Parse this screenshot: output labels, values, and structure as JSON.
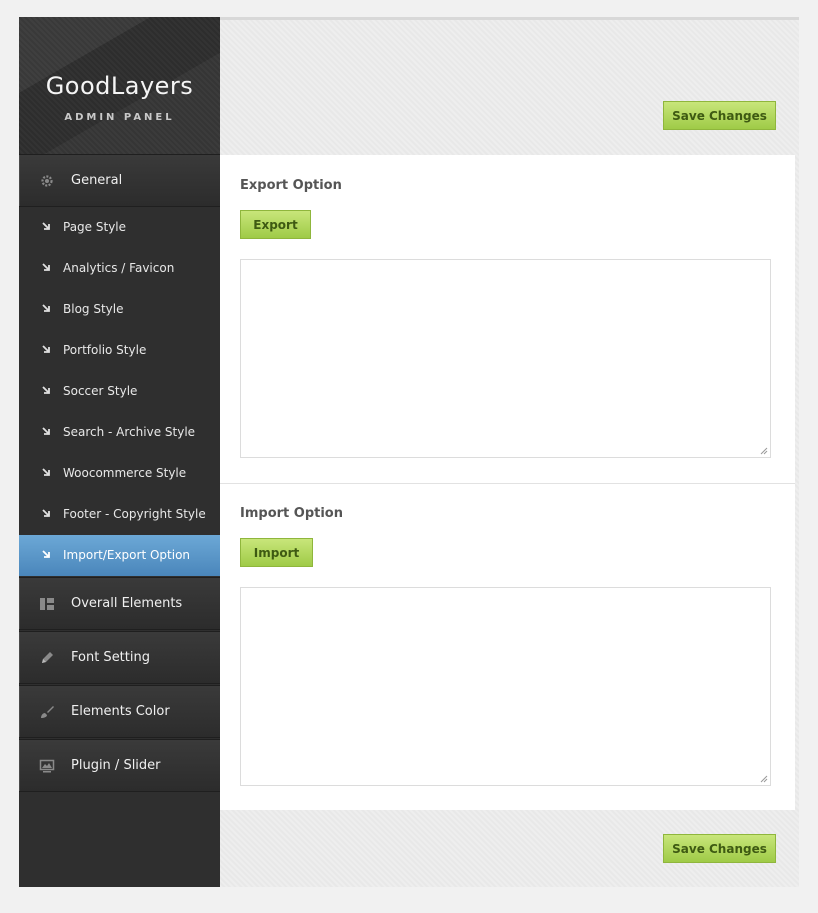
{
  "brand": {
    "title": "GoodLayers",
    "subtitle": "ADMIN PANEL"
  },
  "nav": {
    "general": {
      "label": "General",
      "icon": "gear-icon"
    },
    "sub_items": [
      {
        "label": "Page Style"
      },
      {
        "label": "Analytics / Favicon"
      },
      {
        "label": "Blog Style"
      },
      {
        "label": "Portfolio Style"
      },
      {
        "label": "Soccer Style"
      },
      {
        "label": "Search - Archive Style"
      },
      {
        "label": "Woocommerce Style"
      },
      {
        "label": "Footer - Copyright Style"
      },
      {
        "label": "Import/Export Option",
        "active": true
      }
    ],
    "overall": {
      "label": "Overall Elements",
      "icon": "layout-icon"
    },
    "font": {
      "label": "Font Setting",
      "icon": "pencil-icon"
    },
    "colors": {
      "label": "Elements Color",
      "icon": "brush-icon"
    },
    "plugin": {
      "label": "Plugin / Slider",
      "icon": "slider-icon"
    }
  },
  "toolbar": {
    "save_label": "Save Changes"
  },
  "export_section": {
    "title": "Export Option",
    "button_label": "Export",
    "text_value": ""
  },
  "import_section": {
    "title": "Import Option",
    "button_label": "Import",
    "text_value": ""
  },
  "footer": {
    "save_label": "Save Changes"
  },
  "colors": {
    "accent_green": "#9fcb47",
    "active_blue": "#4a86bb",
    "sidebar": "#2f2f2f"
  }
}
